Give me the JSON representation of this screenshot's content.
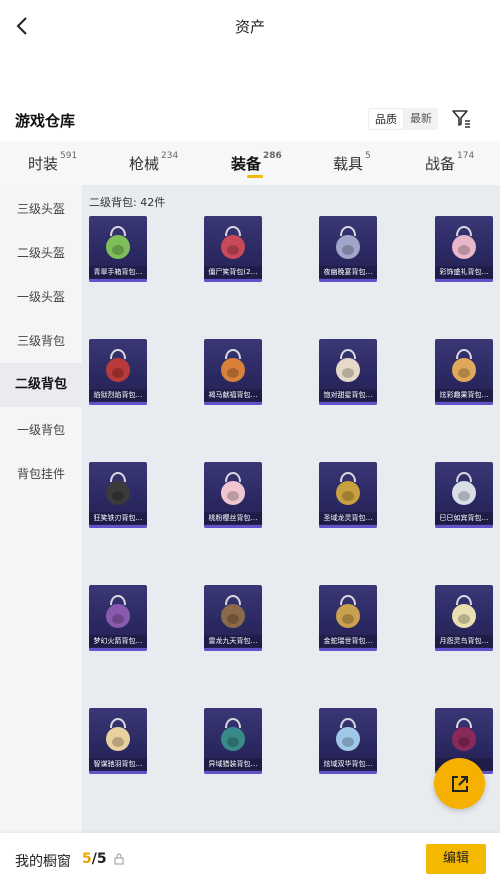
{
  "header": {
    "title": "资产"
  },
  "warehouse": {
    "title": "游戏仓库",
    "sort_options": [
      "品质",
      "最新"
    ],
    "active_sort": "品质"
  },
  "tabs": [
    {
      "label": "时装",
      "count": "591"
    },
    {
      "label": "枪械",
      "count": "234"
    },
    {
      "label": "装备",
      "count": "286"
    },
    {
      "label": "载具",
      "count": "5"
    },
    {
      "label": "战备",
      "count": "174"
    }
  ],
  "active_tab": "装备",
  "sidebar": {
    "items": [
      "三级头盔",
      "二级头盔",
      "一级头盔",
      "三级背包",
      "二级背包",
      "一级背包",
      "背包挂件"
    ],
    "active": "二级背包"
  },
  "content": {
    "count_label": "二级背包: 42件",
    "items": [
      {
        "name": "青翠手箱背包…",
        "icon": "green-backpack-icon"
      },
      {
        "name": "僵尸笑背包(2…",
        "icon": "dark-backpack-icon"
      },
      {
        "name": "夜幽晚宴背包…",
        "icon": "night-backpack-icon"
      },
      {
        "name": "彩饰盛礼背包…",
        "icon": "pink-backpack-icon"
      },
      {
        "name": "焰狱烈焰背包…",
        "icon": "red-backpack-icon"
      },
      {
        "name": "褐马献福背包…",
        "icon": "orange-backpack-icon"
      },
      {
        "name": "饱对甜星背包…",
        "icon": "cup-backpack-icon"
      },
      {
        "name": "炫彩趣果背包…",
        "icon": "ring-backpack-icon"
      },
      {
        "name": "狂笑铁刃背包…",
        "icon": "skull-backpack-icon"
      },
      {
        "name": "桃粉樱丝背包…",
        "icon": "bunny-backpack-icon"
      },
      {
        "name": "圣域龙灵背包…",
        "icon": "gold-backpack-icon"
      },
      {
        "name": "巳巳如宾背包…",
        "icon": "white-backpack-icon"
      },
      {
        "name": "梦幻火箭背包…",
        "icon": "purple-backpack-icon"
      },
      {
        "name": "雷龙九天背包…",
        "icon": "bronze-backpack-icon"
      },
      {
        "name": "金蛇瑞世背包…",
        "icon": "gold-snake-backpack-icon"
      },
      {
        "name": "月怨灵鸟背包…",
        "icon": "moon-backpack-icon"
      },
      {
        "name": "智谋驰羽背包…",
        "icon": "cat-backpack-icon"
      },
      {
        "name": "异域猎装背包…",
        "icon": "teal-backpack-icon"
      },
      {
        "name": "炫域双华背包…",
        "icon": "heart-backpack-icon"
      },
      {
        "name": "红…",
        "icon": "crimson-backpack-icon"
      }
    ]
  },
  "bottom": {
    "showcase_label": "我的橱窗",
    "showcase_current": "5",
    "showcase_total": "/5",
    "edit_label": "编辑"
  },
  "colors": {
    "accent": "#f5b800",
    "card_bg": "#2f2c6a",
    "card_stripe": "#5f54c9"
  }
}
